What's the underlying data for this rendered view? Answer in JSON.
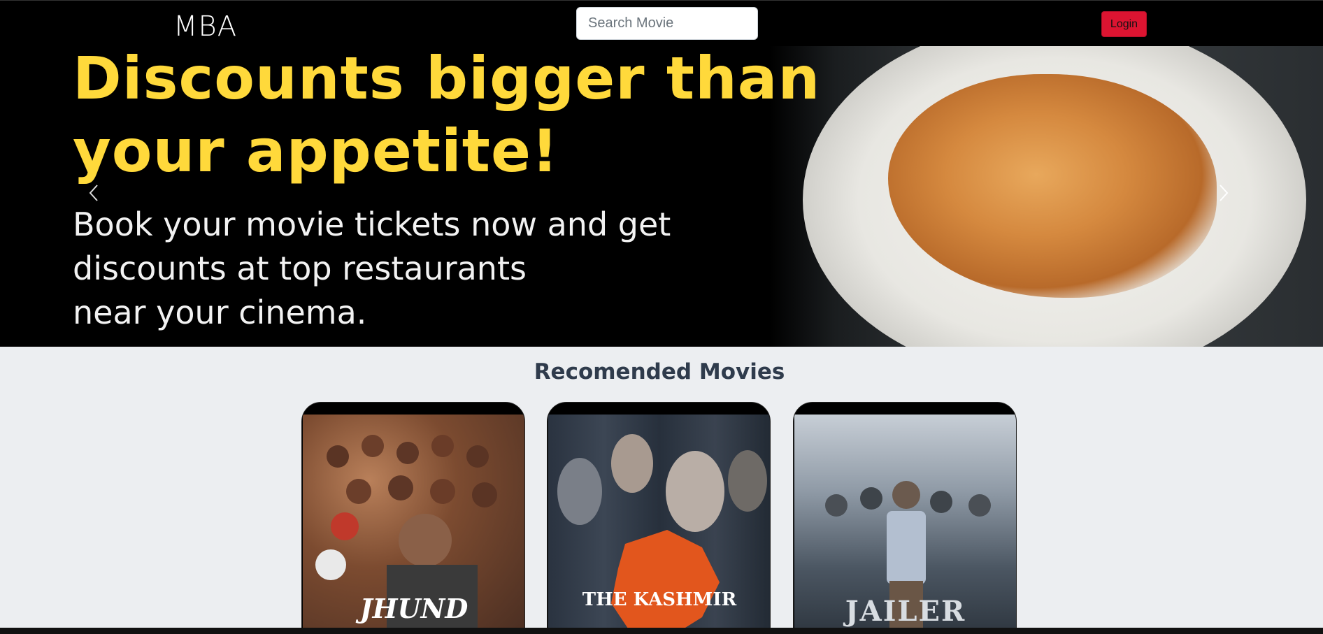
{
  "navbar": {
    "brand": "MBA",
    "search_placeholder": "Search Movie",
    "login_label": "Login"
  },
  "carousel": {
    "headline_line1": "Discounts bigger than",
    "headline_line2": "your appetite!",
    "subline_line1": "Book your movie tickets now and get",
    "subline_line2": "discounts at top restaurants",
    "subline_line3": "near your cinema.",
    "prev_icon": "chevron-left-icon",
    "next_icon": "chevron-right-icon"
  },
  "recommended": {
    "title": "Recomended Movies",
    "movies": [
      {
        "poster_text": "JHUND"
      },
      {
        "poster_text": "THE KASHMIR"
      },
      {
        "poster_text": "JAILER"
      }
    ]
  },
  "colors": {
    "headline": "#ffd93b",
    "login": "#dc1431",
    "page_bg": "#eceef1"
  }
}
